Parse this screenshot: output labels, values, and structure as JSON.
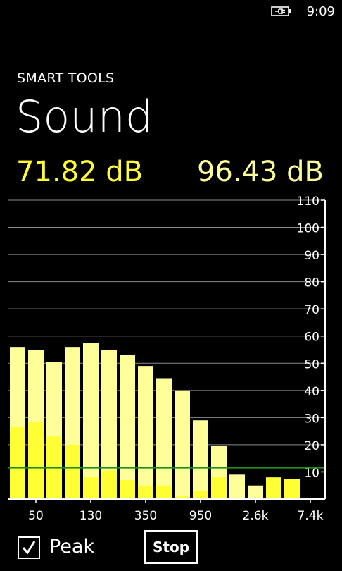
{
  "status_bar": {
    "time": "9:09",
    "battery_icon": "battery-charging-icon"
  },
  "app": {
    "name": "SMART TOOLS"
  },
  "page": {
    "title": "Sound"
  },
  "readings": {
    "current": "71.82 dB",
    "peak": "96.43 dB"
  },
  "controls": {
    "peak_label": "Peak",
    "peak_checked": true,
    "stop_label": "Stop"
  },
  "colors": {
    "current": "#ffff33",
    "peak": "#ffff99",
    "background": "#000000",
    "threshold_line": "#1f8f1f",
    "grid": "#8a8a8a"
  },
  "chart_data": {
    "type": "bar",
    "ylim": [
      0,
      110
    ],
    "y_ticks": [
      "10",
      "20",
      "30",
      "40",
      "50",
      "60",
      "70",
      "80",
      "90",
      "100",
      "110"
    ],
    "x_tick_labels": [
      "50",
      "130",
      "350",
      "950",
      "2.6k",
      "7.4k"
    ],
    "grid": true,
    "threshold": 11.5,
    "series": [
      {
        "values": [
          56,
          55,
          50.5,
          56,
          57.5,
          55,
          53,
          49,
          44.5,
          40,
          29,
          19.5,
          9,
          5,
          0,
          0
        ]
      },
      {
        "values": [
          26.5,
          28.5,
          23,
          20,
          8,
          10.5,
          7,
          5,
          5,
          1,
          3,
          8,
          0,
          0,
          8,
          7.5
        ]
      }
    ]
  }
}
